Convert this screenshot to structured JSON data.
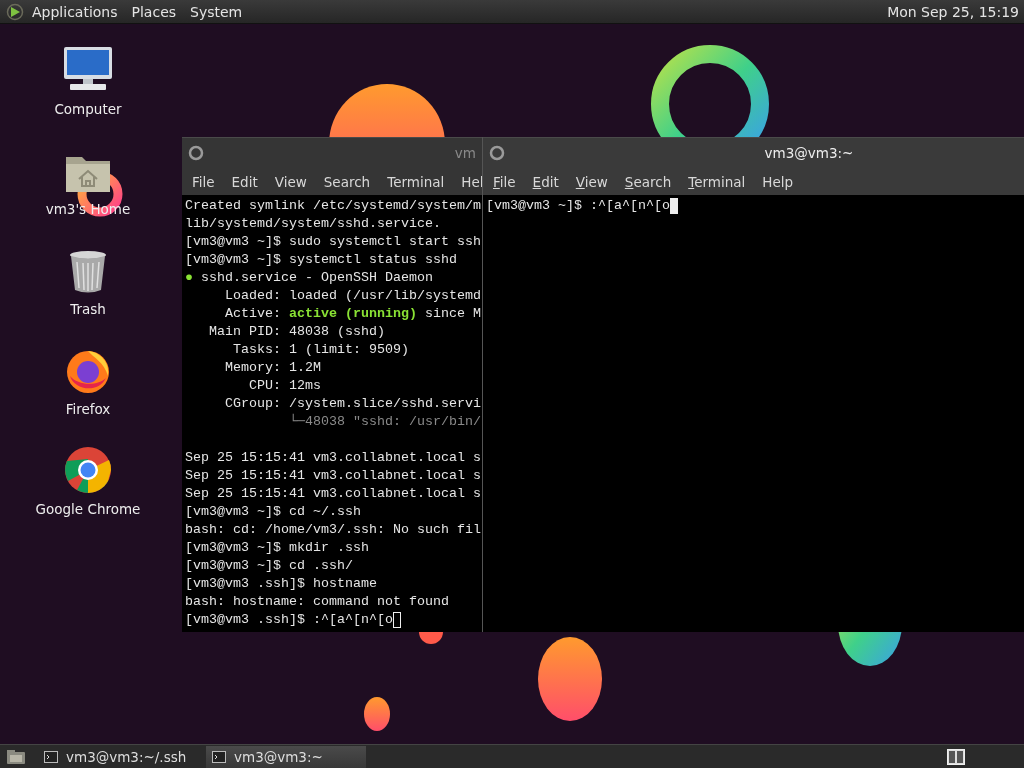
{
  "top_panel": {
    "menus": [
      {
        "label": "Applications"
      },
      {
        "label": "Places"
      },
      {
        "label": "System"
      }
    ],
    "clock": "Mon Sep 25, 15:19"
  },
  "desktop_icons": [
    {
      "label": "Computer",
      "kind": "computer"
    },
    {
      "label": "vm3's Home",
      "kind": "home"
    },
    {
      "label": "Trash",
      "kind": "trash"
    },
    {
      "label": "Firefox",
      "kind": "firefox"
    },
    {
      "label": "Google Chrome",
      "kind": "chrome"
    }
  ],
  "windows": [
    {
      "title": "vm",
      "focused": false,
      "menu": [
        {
          "label": "File",
          "underlined": false
        },
        {
          "label": "Edit",
          "underlined": false
        },
        {
          "label": "View",
          "underlined": false
        },
        {
          "label": "Search",
          "underlined": false
        },
        {
          "label": "Terminal",
          "underlined": false
        },
        {
          "label": "Hel",
          "underlined": false
        }
      ],
      "lines": [
        {
          "kind": "text",
          "text": "Created symlink /etc/systemd/system/m"
        },
        {
          "kind": "text",
          "text": "lib/systemd/system/sshd.service."
        },
        {
          "kind": "text",
          "text": "[vm3@vm3 ~]$ sudo systemctl start ssh"
        },
        {
          "kind": "text",
          "text": "[vm3@vm3 ~]$ systemctl status sshd"
        },
        {
          "kind": "status",
          "bullet": "●",
          "text": " sshd.service - OpenSSH Daemon"
        },
        {
          "kind": "text",
          "text": "     Loaded: loaded (/usr/lib/systemd"
        },
        {
          "kind": "active",
          "text": "     Active: ",
          "highlight": "active (running)",
          "rest": " since M"
        },
        {
          "kind": "text",
          "text": "   Main PID: 48038 (sshd)"
        },
        {
          "kind": "text",
          "text": "      Tasks: 1 (limit: 9509)"
        },
        {
          "kind": "text",
          "text": "     Memory: 1.2M"
        },
        {
          "kind": "text",
          "text": "        CPU: 12ms"
        },
        {
          "kind": "text",
          "text": "     CGroup: /system.slice/sshd.servi"
        },
        {
          "kind": "dim",
          "text": "             └─48038 \"sshd: /usr/bin/"
        },
        {
          "kind": "blank"
        },
        {
          "kind": "text",
          "text": "Sep 25 15:15:41 vm3.collabnet.local s"
        },
        {
          "kind": "text",
          "text": "Sep 25 15:15:41 vm3.collabnet.local s"
        },
        {
          "kind": "text",
          "text": "Sep 25 15:15:41 vm3.collabnet.local s"
        },
        {
          "kind": "text",
          "text": "[vm3@vm3 ~]$ cd ~/.ssh"
        },
        {
          "kind": "text",
          "text": "bash: cd: /home/vm3/.ssh: No such fil"
        },
        {
          "kind": "text",
          "text": "[vm3@vm3 ~]$ mkdir .ssh"
        },
        {
          "kind": "text",
          "text": "[vm3@vm3 ~]$ cd .ssh/"
        },
        {
          "kind": "text",
          "text": "[vm3@vm3 .ssh]$ hostname"
        },
        {
          "kind": "text",
          "text": "bash: hostname: command not found"
        },
        {
          "kind": "input",
          "text": "[vm3@vm3 .ssh]$ :^[a^[n^[o"
        }
      ]
    },
    {
      "title": "vm3@vm3:~",
      "focused": true,
      "menu": [
        {
          "label": "File",
          "underlined": true
        },
        {
          "label": "Edit",
          "underlined": true
        },
        {
          "label": "View",
          "underlined": true
        },
        {
          "label": "Search",
          "underlined": true
        },
        {
          "label": "Terminal",
          "underlined": true
        },
        {
          "label": "Help",
          "underlined": false
        }
      ],
      "lines": [
        {
          "kind": "input",
          "text": "[vm3@vm3 ~]$ :^[a^[n^[o"
        }
      ]
    }
  ],
  "taskbar": {
    "tasks": [
      {
        "label": "vm3@vm3:~/.ssh",
        "selected": false
      },
      {
        "label": "vm3@vm3:~",
        "selected": true
      }
    ]
  }
}
